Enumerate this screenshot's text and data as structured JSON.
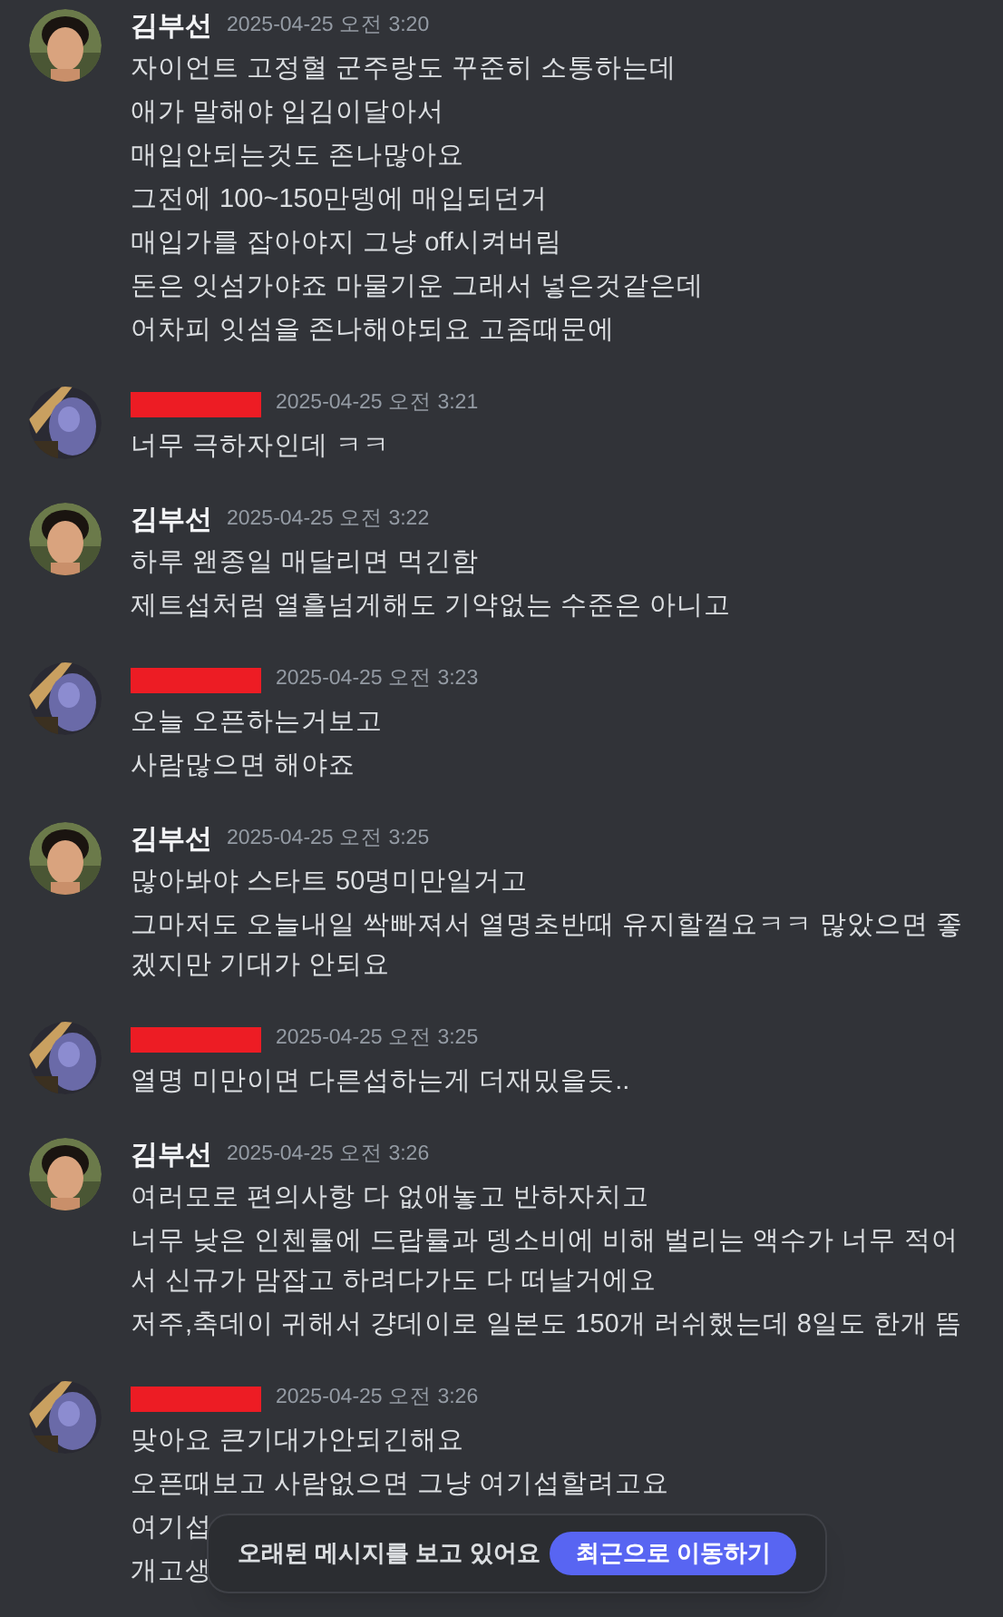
{
  "messages": [
    {
      "author": {
        "name": "김부선",
        "redacted": false
      },
      "avatar": {
        "kind": "picture"
      },
      "time": "2025-04-25 오전 3:20",
      "lines": [
        "자이언트 고정혈 군주랑도 꾸준히 소통하는데",
        "애가 말해야 입김이달아서",
        "매입안되는것도 존나많아요",
        "그전에 100~150만뎅에 매입되던거",
        "매입가를 잡아야지 그냥 off시켜버림",
        "돈은 잇섬가야죠 마물기운 그래서 넣은것같은데",
        "어차피 잇섬을 존나해야되요 고줌때문에"
      ]
    },
    {
      "author": {
        "redacted": true
      },
      "avatar": {
        "kind": "picture"
      },
      "time": "2025-04-25 오전 3:21",
      "lines": [
        "너무 극하자인데 ㅋㅋ"
      ]
    },
    {
      "author": {
        "name": "김부선",
        "redacted": false
      },
      "avatar": {
        "kind": "picture"
      },
      "time": "2025-04-25 오전 3:22",
      "lines": [
        "하루 왠종일 매달리면 먹긴함",
        "제트섭처럼 열흘넘게해도 기약없는 수준은 아니고"
      ]
    },
    {
      "author": {
        "redacted": true
      },
      "avatar": {
        "kind": "picture"
      },
      "time": "2025-04-25 오전 3:23",
      "lines": [
        "오늘 오픈하는거보고",
        "사람많으면 해야죠"
      ]
    },
    {
      "author": {
        "name": "김부선",
        "redacted": false
      },
      "avatar": {
        "kind": "picture"
      },
      "time": "2025-04-25 오전 3:25",
      "lines": [
        "많아봐야 스타트 50명미만일거고",
        "그마저도 오늘내일 싹빠져서 열명초반때 유지할껄요ㅋㅋ 많았으면 좋겠지만 기대가 안되요"
      ]
    },
    {
      "author": {
        "redacted": true
      },
      "avatar": {
        "kind": "picture"
      },
      "time": "2025-04-25 오전 3:25",
      "lines": [
        "열명 미만이면 다른섭하는게 더재밌을듯.."
      ]
    },
    {
      "author": {
        "name": "김부선",
        "redacted": false
      },
      "avatar": {
        "kind": "picture"
      },
      "time": "2025-04-25 오전 3:26",
      "lines": [
        "여러모로 편의사항 다 없애놓고 반하자치고",
        "너무 낮은 인첸률에 드랍률과 뎅소비에 비해 벌리는 액수가 너무 적어서 신규가 맘잡고 하려다가도 다 떠날거에요",
        "저주,축데이 귀해서 걍데이로 일본도 150개 러쉬했는데 8일도 한개 뜸"
      ]
    },
    {
      "author": {
        "redacted": true
      },
      "avatar": {
        "kind": "picture"
      },
      "time": "2025-04-25 오전 3:26",
      "lines": [
        "맞아요 큰기대가안되긴해요",
        "오픈때보고 사람없으면 그냥 여기섭할려고요",
        "여기섭",
        "개고생"
      ]
    }
  ],
  "notice": {
    "text": "오래된 메시지를 보고 있어요",
    "button": "최근으로 이동하기"
  }
}
